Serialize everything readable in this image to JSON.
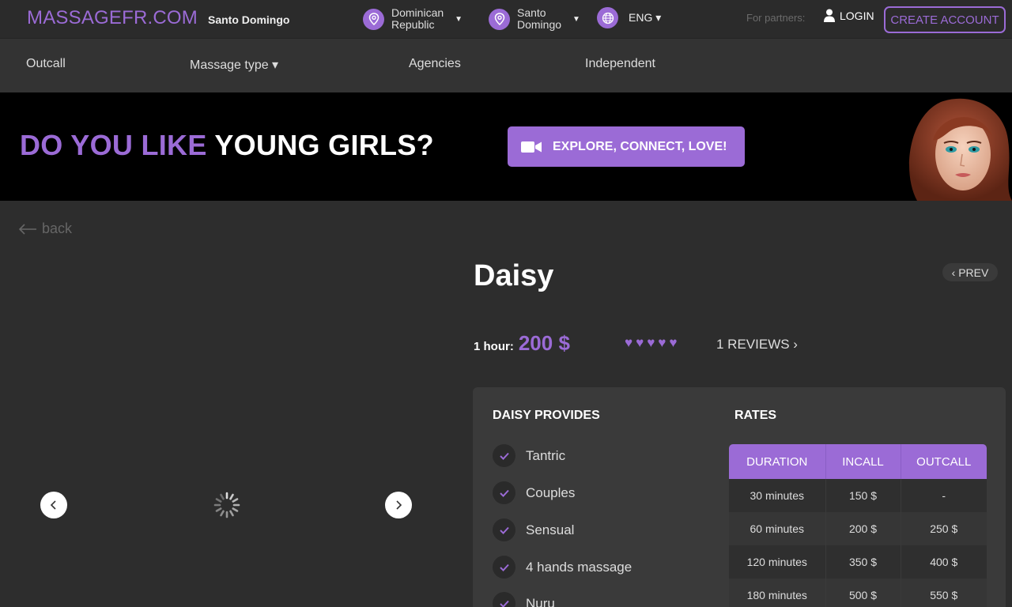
{
  "header": {
    "logo": "MASSAGEFR.COM",
    "city": "Santo Domingo",
    "country_line1": "Dominican",
    "country_line2": "Republic",
    "city_line1": "Santo",
    "city_line2": "Domingo",
    "language": "ENG ▾",
    "partners": "For partners:",
    "login": "LOGIN",
    "create_account": "CREATE ACCOUNT"
  },
  "nav": {
    "outcall": "Outcall",
    "massage_type": "Massage type ▾",
    "agencies": "Agencies",
    "independent": "Independent"
  },
  "banner": {
    "title_purple": "DO YOU LIKE ",
    "title_white": "YOUNG GIRLS?",
    "button": "EXPLORE, CONNECT, LOVE!"
  },
  "profile": {
    "back": "back",
    "name": "Daisy",
    "prev": "‹ PREV",
    "price_label": "1 hour:",
    "price_value": "200 $",
    "rating": 5,
    "reviews": "1 REVIEWS ›"
  },
  "provides": {
    "title": "DAISY PROVIDES",
    "items": [
      "Tantric",
      "Couples",
      "Sensual",
      "4 hands massage",
      "Nuru"
    ]
  },
  "rates": {
    "title": "RATES",
    "headers": [
      "DURATION",
      "INCALL",
      "OUTCALL"
    ],
    "rows": [
      [
        "30 minutes",
        "150 $",
        "-"
      ],
      [
        "60 minutes",
        "200 $",
        "250 $"
      ],
      [
        "120 minutes",
        "350 $",
        "400 $"
      ],
      [
        "180 minutes",
        "500 $",
        "550 $"
      ]
    ]
  },
  "colors": {
    "accent": "#9b6bd6",
    "background": "#2d2d2d",
    "banner": "#000000"
  }
}
